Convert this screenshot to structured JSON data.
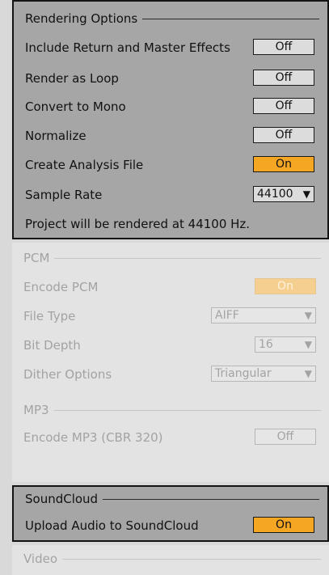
{
  "rendering": {
    "title": "Rendering Options",
    "include_label": "Include Return and Master Effects",
    "include_value": "Off",
    "loop_label": "Render as Loop",
    "loop_value": "Off",
    "mono_label": "Convert to Mono",
    "mono_value": "Off",
    "normalize_label": "Normalize",
    "normalize_value": "Off",
    "analysis_label": "Create Analysis File",
    "analysis_value": "On",
    "sample_rate_label": "Sample Rate",
    "sample_rate_value": "44100",
    "note": "Project will be rendered at 44100 Hz."
  },
  "pcm": {
    "title": "PCM",
    "encode_label": "Encode PCM",
    "encode_value": "On",
    "file_type_label": "File Type",
    "file_type_value": "AIFF",
    "bit_depth_label": "Bit Depth",
    "bit_depth_value": "16",
    "dither_label": "Dither Options",
    "dither_value": "Triangular"
  },
  "mp3": {
    "title": "MP3",
    "encode_label": "Encode MP3 (CBR 320)",
    "encode_value": "Off"
  },
  "soundcloud": {
    "title": "SoundCloud",
    "upload_label": "Upload Audio to SoundCloud",
    "upload_value": "On"
  },
  "video": {
    "title": "Video"
  },
  "icons": {
    "dropdown": "chevron-down-icon"
  },
  "colors": {
    "toggle_on": "#f5a623",
    "toggle_on_faded": "#f4cf8f",
    "panel_dark": "#a6a6a6",
    "panel_light": "#e3e3e3"
  }
}
